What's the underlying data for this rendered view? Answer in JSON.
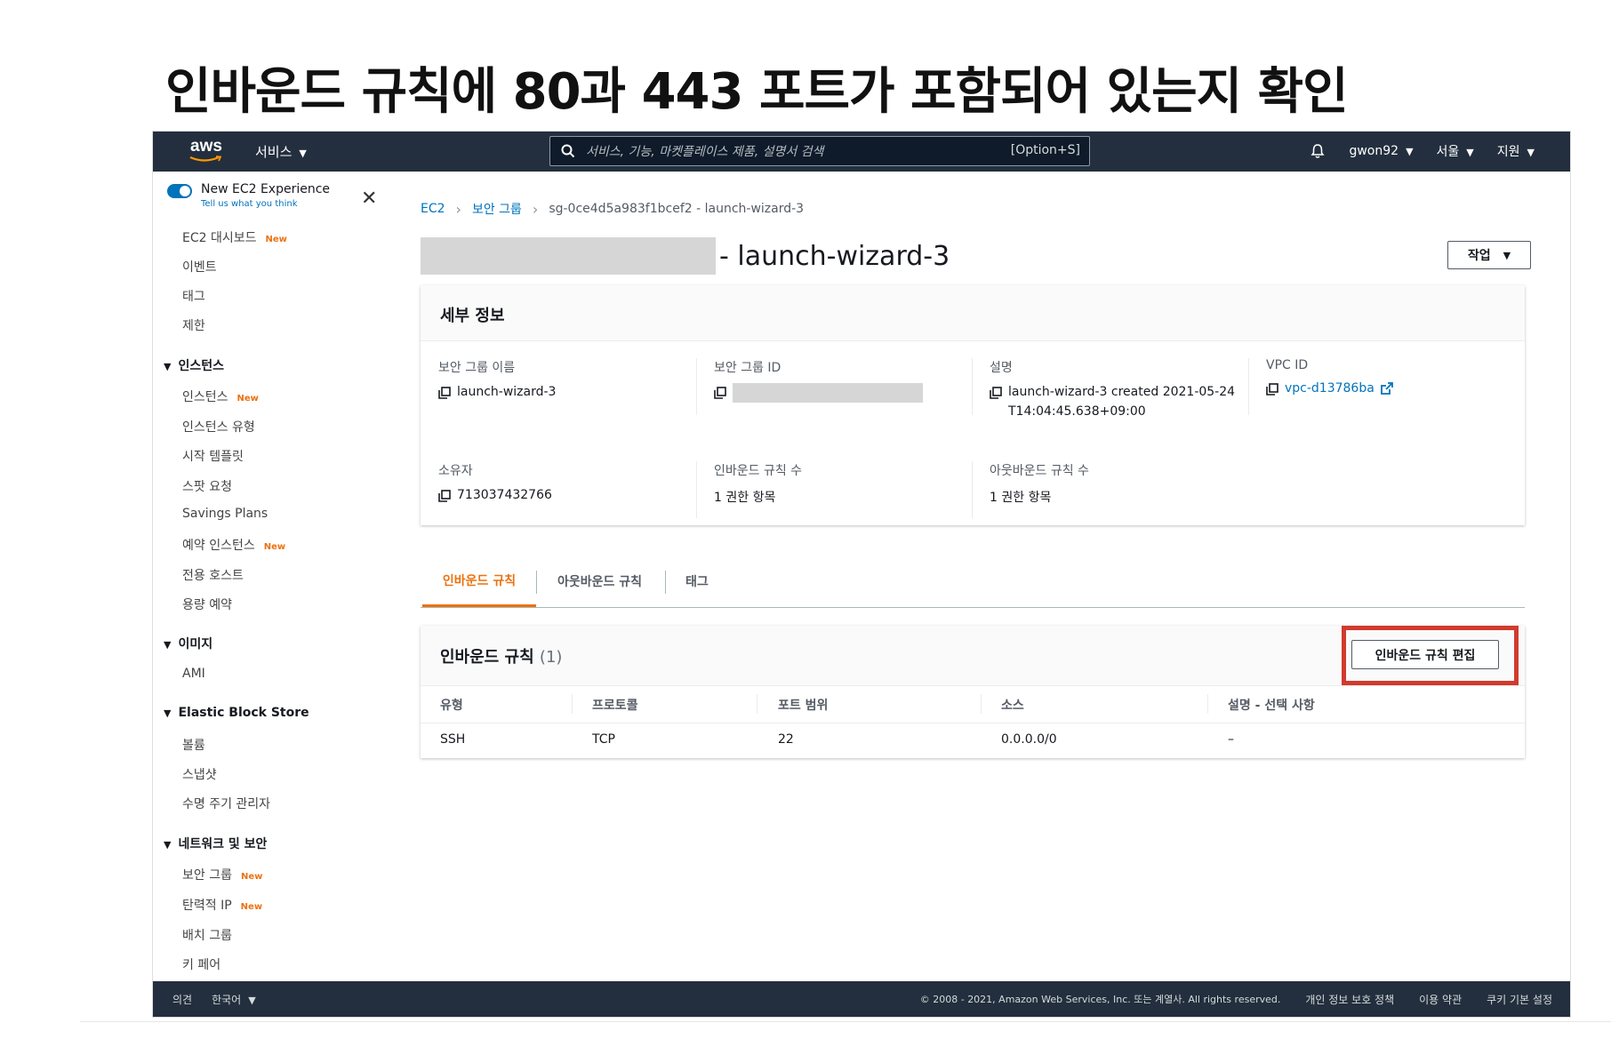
{
  "slide": {
    "title": "인바운드 규칙에 80과 443 포트가 포함되어 있는지 확인"
  },
  "topnav": {
    "logo_text": "aws",
    "services_label": "서비스",
    "search_placeholder": "서비스, 기능, 마켓플레이스 제품, 설명서 검색",
    "search_shortcut": "[Option+S]",
    "user": "gwon92",
    "region": "서울",
    "support": "지원"
  },
  "sidebar": {
    "toggle_label": "New EC2 Experience",
    "toggle_sub": "Tell us what you think",
    "new_badge": "New",
    "items": [
      {
        "label": "EC2 대시보드",
        "new": true
      },
      {
        "label": "이벤트"
      },
      {
        "label": "태그"
      },
      {
        "label": "제한"
      }
    ],
    "sections": [
      {
        "title": "인스턴스",
        "items": [
          "인스턴스",
          "인스턴스 유형",
          "시작 템플릿",
          "스팟 요청",
          "Savings Plans",
          "예약 인스턴스",
          "전용 호스트",
          "용량 예약"
        ]
      },
      {
        "title": "이미지",
        "items": [
          "AMI"
        ]
      },
      {
        "title": "Elastic Block Store",
        "items": [
          "볼륨",
          "스냅샷",
          "수명 주기 관리자"
        ]
      },
      {
        "title": "네트워크 및 보안",
        "items": [
          "보안 그룹",
          "탄력적 IP",
          "배치 그룹",
          "키 페어"
        ]
      }
    ]
  },
  "breadcrumb": {
    "ec2": "EC2",
    "security_groups": "보안 그룹",
    "current": "sg-0ce4d5a983f1bcef2 - launch-wizard-3"
  },
  "page": {
    "title_suffix": "- launch-wizard-3",
    "action_label": "작업"
  },
  "details": {
    "heading": "세부 정보",
    "sg_name_label": "보안 그룹 이름",
    "sg_name_value": "launch-wizard-3",
    "sg_id_label": "보안 그룹 ID",
    "desc_label": "설명",
    "desc_value": "launch-wizard-3 created 2021-05-24T14:04:45.638+09:00",
    "vpc_label": "VPC ID",
    "vpc_value": "vpc-d13786ba",
    "owner_label": "소유자",
    "owner_value": "713037432766",
    "inbound_count_label": "인바운드 규칙 수",
    "inbound_count_value": "1 권한 항목",
    "outbound_count_label": "아웃바운드 규칙 수",
    "outbound_count_value": "1 권한 항목"
  },
  "tabs": {
    "inbound": "인바운드 규칙",
    "outbound": "아웃바운드 규칙",
    "tags": "태그"
  },
  "rules": {
    "heading": "인바운드 규칙",
    "count": "(1)",
    "edit_label": "인바운드 규칙 편집",
    "highlight_color": "#d13a2e",
    "columns": {
      "type": "유형",
      "protocol": "프로토콜",
      "port": "포트 범위",
      "source": "소스",
      "desc": "설명 - 선택 사항"
    },
    "row": {
      "type": "SSH",
      "protocol": "TCP",
      "port": "22",
      "source": "0.0.0.0/0",
      "desc": "–"
    }
  },
  "footer": {
    "feedback": "의견",
    "language": "한국어",
    "copyright": "© 2008 - 2021, Amazon Web Services, Inc. 또는 계열사. All rights reserved.",
    "privacy": "개인 정보 보호 정책",
    "terms": "이용 약관",
    "cookies": "쿠키 기본 설정"
  },
  "colors": {
    "nav_bg": "#232f3e",
    "accent_orange": "#ec7211",
    "link_blue": "#0073bb"
  }
}
